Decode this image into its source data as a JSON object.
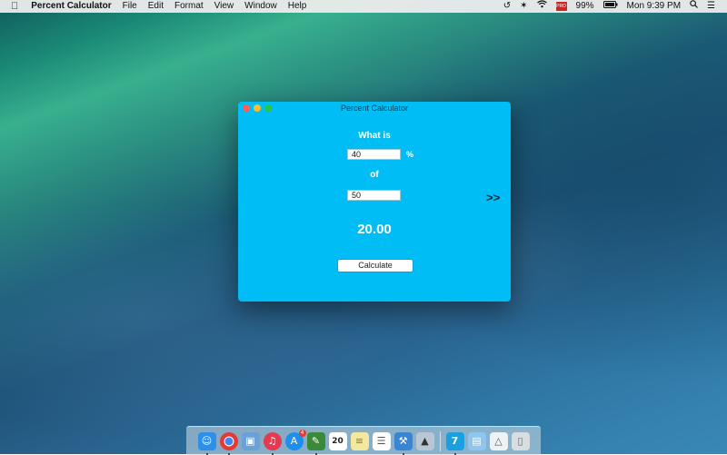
{
  "menubar": {
    "apple_icon": "",
    "app_name": "Percent Calculator",
    "items": [
      "File",
      "Edit",
      "Format",
      "View",
      "Window",
      "Help"
    ],
    "status": {
      "battery": "99%",
      "clock": "Mon 9:39 PM",
      "pro_badge": "PRO"
    }
  },
  "window": {
    "title": "Percent Calculator",
    "label_what_is": "What is",
    "percent_value": "40",
    "percent_sign": "%",
    "label_of": "of",
    "base_value": "50",
    "result": "20.00",
    "calculate_label": "Calculate",
    "expand_label": ">>"
  },
  "dock": {
    "apps": [
      "finder",
      "chrome",
      "preview",
      "itunes",
      "app-store",
      "evernote",
      "calendar",
      "notes",
      "reminders",
      "xcode",
      "instruments"
    ],
    "calendar_day": "20",
    "app_store_badge": "4",
    "persistent": [
      "percent-calculator",
      "documents-folder",
      "downloads-stack",
      "trash"
    ],
    "app7_label": "7"
  },
  "colors": {
    "window_bg": "#00bdf6",
    "close": "#fc5f57",
    "minimize": "#fdbc2e",
    "zoom": "#27c840"
  }
}
